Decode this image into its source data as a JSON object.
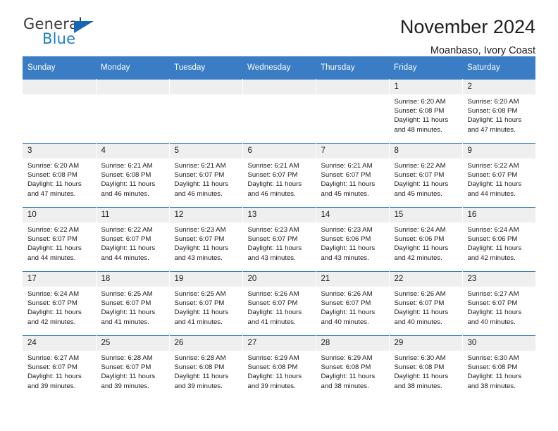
{
  "brand": {
    "word1": "General",
    "word2": "Blue",
    "triangle_color": "#1565b5",
    "word2_color": "#1e7fc4"
  },
  "header": {
    "title": "November 2024",
    "subtitle": "Moanbaso, Ivory Coast"
  },
  "theme": {
    "header_blue": "#3a7dc4",
    "daynum_band": "#efefef",
    "text": "#1a1a1a"
  },
  "weekdays": [
    "Sunday",
    "Monday",
    "Tuesday",
    "Wednesday",
    "Thursday",
    "Friday",
    "Saturday"
  ],
  "labels": {
    "sunrise_prefix": "Sunrise:",
    "sunset_prefix": "Sunset:",
    "daylight_prefix": "Daylight:"
  },
  "weeks": [
    [
      {
        "day": ""
      },
      {
        "day": ""
      },
      {
        "day": ""
      },
      {
        "day": ""
      },
      {
        "day": ""
      },
      {
        "day": "1",
        "sunrise": "Sunrise: 6:20 AM",
        "sunset": "Sunset: 6:08 PM",
        "daylight_l1": "Daylight: 11 hours",
        "daylight_l2": "and 48 minutes."
      },
      {
        "day": "2",
        "sunrise": "Sunrise: 6:20 AM",
        "sunset": "Sunset: 6:08 PM",
        "daylight_l1": "Daylight: 11 hours",
        "daylight_l2": "and 47 minutes."
      }
    ],
    [
      {
        "day": "3",
        "sunrise": "Sunrise: 6:20 AM",
        "sunset": "Sunset: 6:08 PM",
        "daylight_l1": "Daylight: 11 hours",
        "daylight_l2": "and 47 minutes."
      },
      {
        "day": "4",
        "sunrise": "Sunrise: 6:21 AM",
        "sunset": "Sunset: 6:08 PM",
        "daylight_l1": "Daylight: 11 hours",
        "daylight_l2": "and 46 minutes."
      },
      {
        "day": "5",
        "sunrise": "Sunrise: 6:21 AM",
        "sunset": "Sunset: 6:07 PM",
        "daylight_l1": "Daylight: 11 hours",
        "daylight_l2": "and 46 minutes."
      },
      {
        "day": "6",
        "sunrise": "Sunrise: 6:21 AM",
        "sunset": "Sunset: 6:07 PM",
        "daylight_l1": "Daylight: 11 hours",
        "daylight_l2": "and 46 minutes."
      },
      {
        "day": "7",
        "sunrise": "Sunrise: 6:21 AM",
        "sunset": "Sunset: 6:07 PM",
        "daylight_l1": "Daylight: 11 hours",
        "daylight_l2": "and 45 minutes."
      },
      {
        "day": "8",
        "sunrise": "Sunrise: 6:22 AM",
        "sunset": "Sunset: 6:07 PM",
        "daylight_l1": "Daylight: 11 hours",
        "daylight_l2": "and 45 minutes."
      },
      {
        "day": "9",
        "sunrise": "Sunrise: 6:22 AM",
        "sunset": "Sunset: 6:07 PM",
        "daylight_l1": "Daylight: 11 hours",
        "daylight_l2": "and 44 minutes."
      }
    ],
    [
      {
        "day": "10",
        "sunrise": "Sunrise: 6:22 AM",
        "sunset": "Sunset: 6:07 PM",
        "daylight_l1": "Daylight: 11 hours",
        "daylight_l2": "and 44 minutes."
      },
      {
        "day": "11",
        "sunrise": "Sunrise: 6:22 AM",
        "sunset": "Sunset: 6:07 PM",
        "daylight_l1": "Daylight: 11 hours",
        "daylight_l2": "and 44 minutes."
      },
      {
        "day": "12",
        "sunrise": "Sunrise: 6:23 AM",
        "sunset": "Sunset: 6:07 PM",
        "daylight_l1": "Daylight: 11 hours",
        "daylight_l2": "and 43 minutes."
      },
      {
        "day": "13",
        "sunrise": "Sunrise: 6:23 AM",
        "sunset": "Sunset: 6:07 PM",
        "daylight_l1": "Daylight: 11 hours",
        "daylight_l2": "and 43 minutes."
      },
      {
        "day": "14",
        "sunrise": "Sunrise: 6:23 AM",
        "sunset": "Sunset: 6:06 PM",
        "daylight_l1": "Daylight: 11 hours",
        "daylight_l2": "and 43 minutes."
      },
      {
        "day": "15",
        "sunrise": "Sunrise: 6:24 AM",
        "sunset": "Sunset: 6:06 PM",
        "daylight_l1": "Daylight: 11 hours",
        "daylight_l2": "and 42 minutes."
      },
      {
        "day": "16",
        "sunrise": "Sunrise: 6:24 AM",
        "sunset": "Sunset: 6:06 PM",
        "daylight_l1": "Daylight: 11 hours",
        "daylight_l2": "and 42 minutes."
      }
    ],
    [
      {
        "day": "17",
        "sunrise": "Sunrise: 6:24 AM",
        "sunset": "Sunset: 6:07 PM",
        "daylight_l1": "Daylight: 11 hours",
        "daylight_l2": "and 42 minutes."
      },
      {
        "day": "18",
        "sunrise": "Sunrise: 6:25 AM",
        "sunset": "Sunset: 6:07 PM",
        "daylight_l1": "Daylight: 11 hours",
        "daylight_l2": "and 41 minutes."
      },
      {
        "day": "19",
        "sunrise": "Sunrise: 6:25 AM",
        "sunset": "Sunset: 6:07 PM",
        "daylight_l1": "Daylight: 11 hours",
        "daylight_l2": "and 41 minutes."
      },
      {
        "day": "20",
        "sunrise": "Sunrise: 6:26 AM",
        "sunset": "Sunset: 6:07 PM",
        "daylight_l1": "Daylight: 11 hours",
        "daylight_l2": "and 41 minutes."
      },
      {
        "day": "21",
        "sunrise": "Sunrise: 6:26 AM",
        "sunset": "Sunset: 6:07 PM",
        "daylight_l1": "Daylight: 11 hours",
        "daylight_l2": "and 40 minutes."
      },
      {
        "day": "22",
        "sunrise": "Sunrise: 6:26 AM",
        "sunset": "Sunset: 6:07 PM",
        "daylight_l1": "Daylight: 11 hours",
        "daylight_l2": "and 40 minutes."
      },
      {
        "day": "23",
        "sunrise": "Sunrise: 6:27 AM",
        "sunset": "Sunset: 6:07 PM",
        "daylight_l1": "Daylight: 11 hours",
        "daylight_l2": "and 40 minutes."
      }
    ],
    [
      {
        "day": "24",
        "sunrise": "Sunrise: 6:27 AM",
        "sunset": "Sunset: 6:07 PM",
        "daylight_l1": "Daylight: 11 hours",
        "daylight_l2": "and 39 minutes."
      },
      {
        "day": "25",
        "sunrise": "Sunrise: 6:28 AM",
        "sunset": "Sunset: 6:07 PM",
        "daylight_l1": "Daylight: 11 hours",
        "daylight_l2": "and 39 minutes."
      },
      {
        "day": "26",
        "sunrise": "Sunrise: 6:28 AM",
        "sunset": "Sunset: 6:08 PM",
        "daylight_l1": "Daylight: 11 hours",
        "daylight_l2": "and 39 minutes."
      },
      {
        "day": "27",
        "sunrise": "Sunrise: 6:29 AM",
        "sunset": "Sunset: 6:08 PM",
        "daylight_l1": "Daylight: 11 hours",
        "daylight_l2": "and 39 minutes."
      },
      {
        "day": "28",
        "sunrise": "Sunrise: 6:29 AM",
        "sunset": "Sunset: 6:08 PM",
        "daylight_l1": "Daylight: 11 hours",
        "daylight_l2": "and 38 minutes."
      },
      {
        "day": "29",
        "sunrise": "Sunrise: 6:30 AM",
        "sunset": "Sunset: 6:08 PM",
        "daylight_l1": "Daylight: 11 hours",
        "daylight_l2": "and 38 minutes."
      },
      {
        "day": "30",
        "sunrise": "Sunrise: 6:30 AM",
        "sunset": "Sunset: 6:08 PM",
        "daylight_l1": "Daylight: 11 hours",
        "daylight_l2": "and 38 minutes."
      }
    ]
  ]
}
